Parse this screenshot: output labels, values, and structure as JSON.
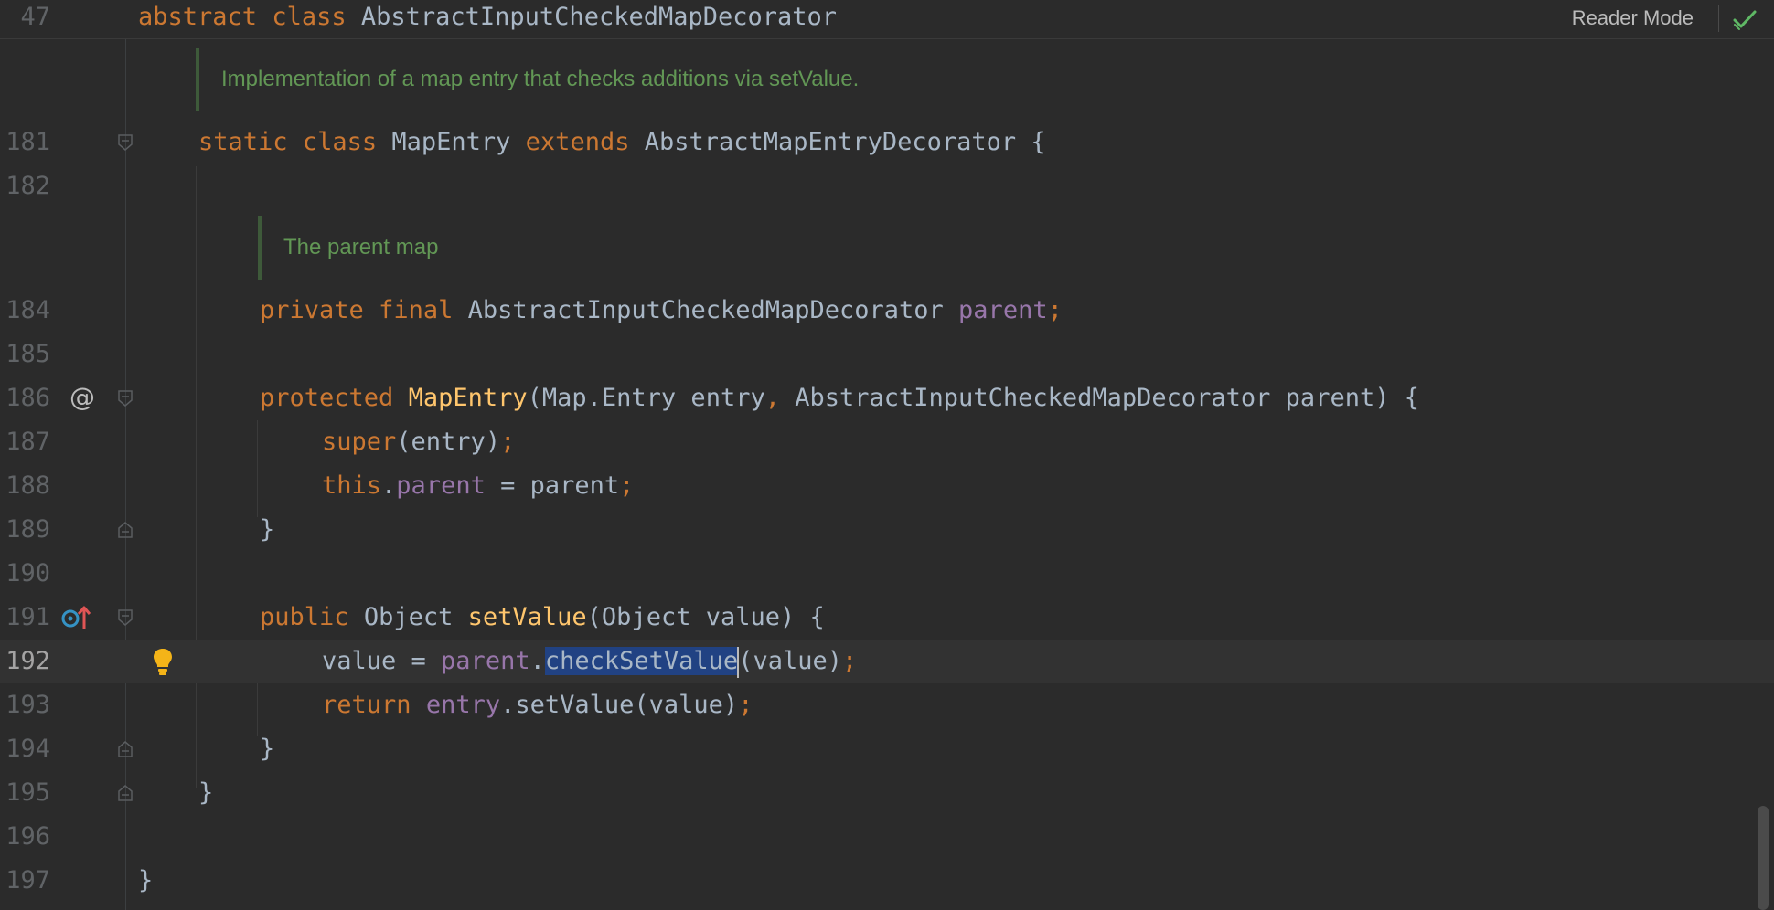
{
  "sticky_header": {
    "line_number": "47",
    "keyword_abstract": "abstract",
    "keyword_class": "class",
    "class_name": "AbstractInputCheckedMapDecorator",
    "reader_mode_label": "Reader Mode"
  },
  "doc_comments": {
    "class_doc": "Implementation of a map entry that checks additions via setValue.",
    "field_doc": "The parent map"
  },
  "lines": {
    "l181": {
      "num": "181",
      "kw_static": "static",
      "kw_class": "class",
      "name": "MapEntry",
      "kw_extends": "extends",
      "super": "AbstractMapEntryDecorator",
      "brace": "{"
    },
    "l182": {
      "num": "182"
    },
    "l184": {
      "num": "184",
      "kw_private": "private",
      "kw_final": "final",
      "type": "AbstractInputCheckedMapDecorator",
      "field": "parent",
      "semi": ";"
    },
    "l185": {
      "num": "185"
    },
    "l186": {
      "num": "186",
      "kw_protected": "protected",
      "ctor": "MapEntry",
      "p1": "(Map.Entry entry",
      "comma": ",",
      "p2": "AbstractInputCheckedMapDecorator parent) {"
    },
    "l187": {
      "num": "187",
      "kw_super": "super",
      "args": "(entry)",
      "semi": ";"
    },
    "l188": {
      "num": "188",
      "kw_this": "this",
      "dot": ".",
      "field": "parent",
      "rest": " = parent",
      "semi": ";"
    },
    "l189": {
      "num": "189",
      "brace": "}"
    },
    "l190": {
      "num": "190"
    },
    "l191": {
      "num": "191",
      "kw_public": "public",
      "type": "Object",
      "method": "setValue",
      "params": "(Object value) {"
    },
    "l192": {
      "num": "192",
      "lhs": "value = ",
      "field": "parent",
      "dot": ".",
      "selected": "checkSetValue",
      "args": "(value)",
      "semi": ";"
    },
    "l193": {
      "num": "193",
      "kw_return": "return",
      "field": "entry",
      "call": ".setValue(value)",
      "semi": ";"
    },
    "l194": {
      "num": "194",
      "brace": "}"
    },
    "l195": {
      "num": "195",
      "brace": "}"
    },
    "l196": {
      "num": "196"
    },
    "l197": {
      "num": "197",
      "brace": "}"
    }
  },
  "gutter_icons": {
    "l186": "at-sign-icon",
    "l191": "implements-override-icon",
    "l192": "lightbulb-icon"
  },
  "colors": {
    "background": "#2b2b2b",
    "keyword": "#cc7832",
    "text": "#a9b7c6",
    "method": "#ffc66d",
    "field": "#9876aa",
    "doc_comment": "#629755",
    "selection": "#214283",
    "current_line": "#323232",
    "line_number": "#606366"
  },
  "at_symbol": "@"
}
